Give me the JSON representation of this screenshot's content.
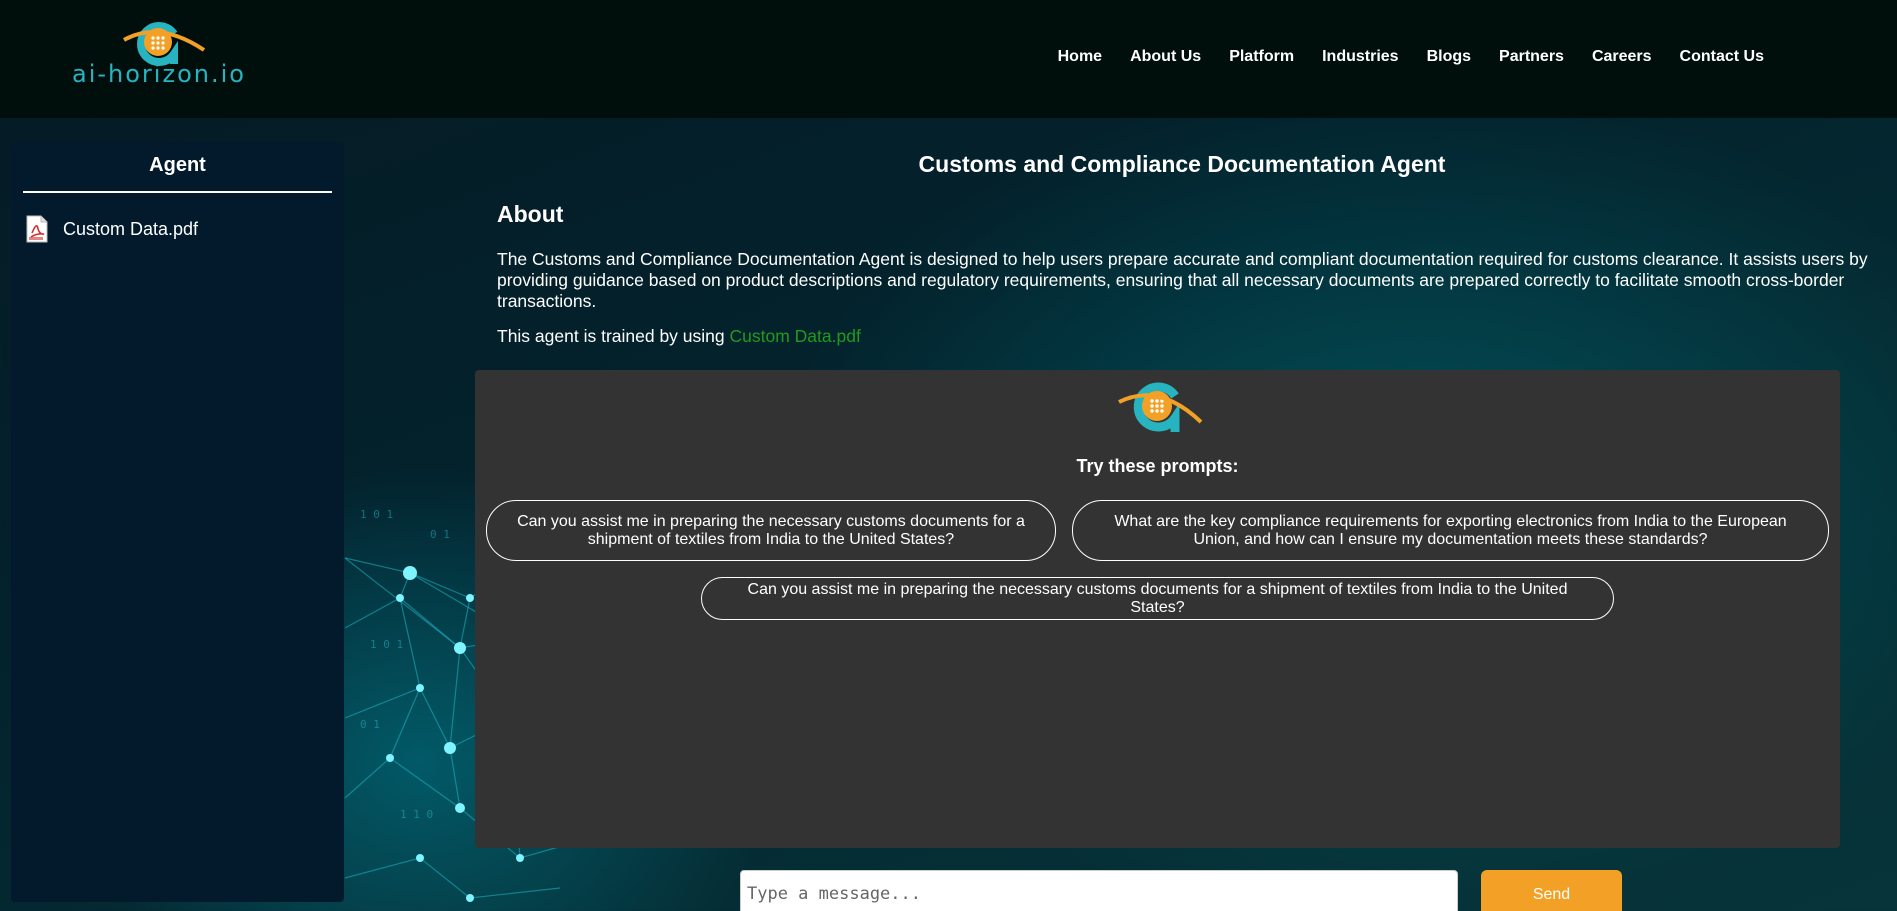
{
  "header": {
    "logo_text": "ai-horizon.io",
    "nav": [
      "Home",
      "About Us",
      "Platform",
      "Industries",
      "Blogs",
      "Partners",
      "Careers",
      "Contact Us"
    ]
  },
  "sidebar": {
    "title": "Agent",
    "files": [
      {
        "name": "Custom Data.pdf",
        "icon": "pdf-icon"
      }
    ]
  },
  "main": {
    "title": "Customs and Compliance Documentation Agent",
    "about_heading": "About",
    "about_text": "The Customs and Compliance Documentation Agent is designed to help users prepare accurate and compliant documentation required for customs clearance. It assists users by providing guidance based on product descriptions and regulatory requirements, ensuring that all necessary documents are prepared correctly to facilitate smooth cross-border transactions.",
    "trained_prefix": "This agent is trained by using ",
    "trained_file": "Custom Data.pdf"
  },
  "chat": {
    "try_title": "Try these prompts:",
    "prompts": [
      "Can you assist me in preparing the necessary customs documents for a shipment of textiles from India to the United States?",
      "What are the key compliance requirements for exporting electronics from India to the European Union, and how can I ensure my documentation meets these standards?",
      "Can you assist me in preparing the necessary customs documents for a shipment of textiles from India to the United States?"
    ],
    "input_placeholder": "Type a message...",
    "send_label": "Send"
  },
  "colors": {
    "accent_orange": "#f2a126",
    "accent_teal": "#27b3bf",
    "link_green": "#1f9c1f",
    "chat_panel": "#333333",
    "header_bg": "#010f0c"
  }
}
